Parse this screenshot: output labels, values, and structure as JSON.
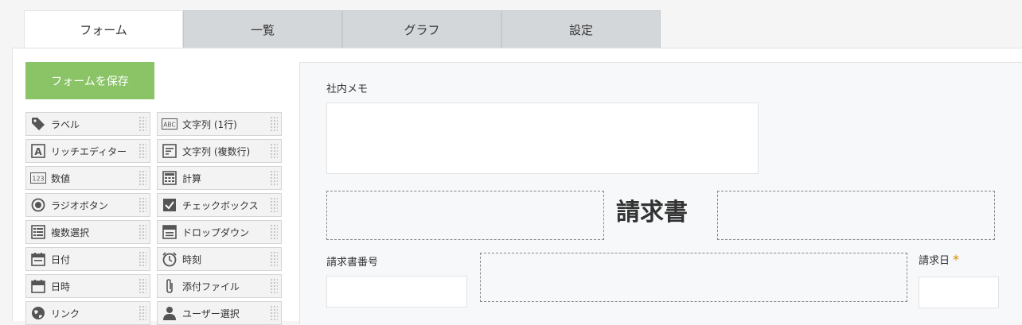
{
  "tabs": [
    {
      "label": "フォーム"
    },
    {
      "label": "一覧"
    },
    {
      "label": "グラフ"
    },
    {
      "label": "設定"
    }
  ],
  "save_button": "フォームを保存",
  "palette": {
    "left": [
      {
        "label": "ラベル",
        "icon": "tag-icon"
      },
      {
        "label": "リッチエディター",
        "icon": "rich-editor-icon"
      },
      {
        "label": "数値",
        "icon": "number-icon"
      },
      {
        "label": "ラジオボタン",
        "icon": "radio-icon"
      },
      {
        "label": "複数選択",
        "icon": "multi-select-icon"
      },
      {
        "label": "日付",
        "icon": "calendar-icon"
      },
      {
        "label": "日時",
        "icon": "calendar-clock-icon"
      },
      {
        "label": "リンク",
        "icon": "globe-icon"
      }
    ],
    "right": [
      {
        "label": "文字列 (1行)",
        "icon": "abc-icon"
      },
      {
        "label": "文字列 (複数行)",
        "icon": "multiline-text-icon"
      },
      {
        "label": "計算",
        "icon": "calculator-icon"
      },
      {
        "label": "チェックボックス",
        "icon": "checkbox-icon"
      },
      {
        "label": "ドロップダウン",
        "icon": "dropdown-icon"
      },
      {
        "label": "時刻",
        "icon": "alarm-clock-icon"
      },
      {
        "label": "添付ファイル",
        "icon": "paperclip-icon"
      },
      {
        "label": "ユーザー選択",
        "icon": "user-icon"
      }
    ]
  },
  "form": {
    "memo_label": "社内メモ",
    "heading": "請求書",
    "invoice_no_label": "請求書番号",
    "invoice_date_label": "請求日",
    "required_mark": "*"
  }
}
